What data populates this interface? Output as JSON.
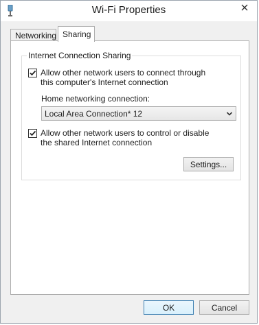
{
  "window": {
    "title": "Wi-Fi Properties",
    "icon": "network-adapter-icon",
    "close_icon": "close-icon"
  },
  "tabs": [
    {
      "label": "Networking",
      "active": false
    },
    {
      "label": "Sharing",
      "active": true
    }
  ],
  "sharing": {
    "group_title": "Internet Connection Sharing",
    "allow_connect": {
      "checked": true,
      "label": "Allow other network users to connect through this computer's Internet connection"
    },
    "home_label": "Home networking connection:",
    "home_select_value": "Local Area Connection* 12",
    "allow_control": {
      "checked": true,
      "label": "Allow other network users to control or disable the shared Internet connection"
    },
    "settings_label": "Settings..."
  },
  "buttons": {
    "ok": "OK",
    "cancel": "Cancel"
  }
}
